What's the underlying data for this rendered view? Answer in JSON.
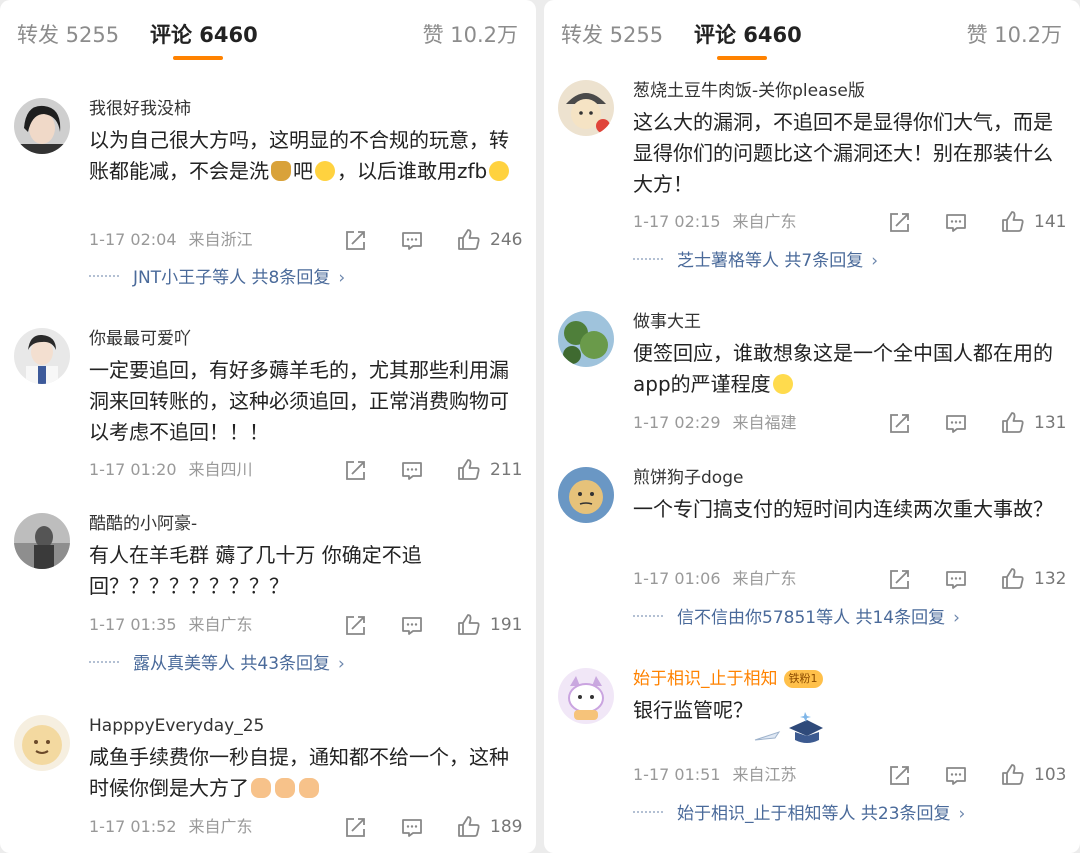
{
  "tabs": {
    "repost": "转发 5255",
    "comments": "评论 6460",
    "likes": "赞 10.2万"
  },
  "colors": {
    "accent": "#ff8200",
    "link": "#4a6a9a",
    "meta": "#999999"
  },
  "icons": {
    "share": "share-icon",
    "comment": "comment-icon",
    "like": "thumb-up-icon",
    "more": "chevron-right-icon"
  },
  "left_comments": [
    {
      "user": "我很好我没柿",
      "text_parts": [
        "以为自己很大方吗，这明显的不合规的玩意，转账都能减，不会是洗",
        "吧",
        "，以后谁敢用zfb"
      ],
      "time": "1-17 02:04",
      "location": "来自浙江",
      "likes": "246",
      "replies": "JNT小王子等人  共8条回复"
    },
    {
      "user": "你最最可爱吖",
      "text": "一定要追回，有好多薅羊毛的，尤其那些利用漏洞来回转账的，这种必须追回，正常消费购物可以考虑不追回！！！",
      "time": "1-17 01:20",
      "location": "来自四川",
      "likes": "211"
    },
    {
      "user": "酷酷的小阿豪-",
      "text": "有人在羊毛群  薅了几十万  你确定不追回？？？？？？？？？",
      "time": "1-17 01:35",
      "location": "来自广东",
      "likes": "191",
      "replies": "露从真美等人  共43条回复"
    },
    {
      "user": "HapppyEveryday_25",
      "text": "咸鱼手续费你一秒自提，通知都不给一个，这种时候你倒是大方了",
      "time": "1-17 01:52",
      "location": "来自广东",
      "likes": "189"
    }
  ],
  "right_comments": [
    {
      "user": "葱烧土豆牛肉饭-关你please版",
      "text": "这么大的漏洞，不追回不是显得你们大气，而是显得你们的问题比这个漏洞还大！别在那装什么大方！",
      "time": "1-17 02:15",
      "location": "来自广东",
      "likes": "141",
      "replies": "芝士薯格等人  共7条回复"
    },
    {
      "user": "做事大王",
      "text": "便签回应，谁敢想象这是一个全中国人都在用的app的严谨程度",
      "time": "1-17 02:29",
      "location": "来自福建",
      "likes": "131"
    },
    {
      "user": "煎饼狗子doge",
      "text": "一个专门搞支付的短时间内连续两次重大事故？",
      "time": "1-17 01:06",
      "location": "来自广东",
      "likes": "132",
      "replies": "信不信由你57851等人  共14条回复"
    },
    {
      "user": "始于相识_止于相知",
      "badge": "铁粉1",
      "text": "银行监管呢？",
      "time": "1-17 01:51",
      "location": "来自江苏",
      "likes": "103",
      "replies": "始于相识_止于相知等人  共23条回复"
    }
  ]
}
